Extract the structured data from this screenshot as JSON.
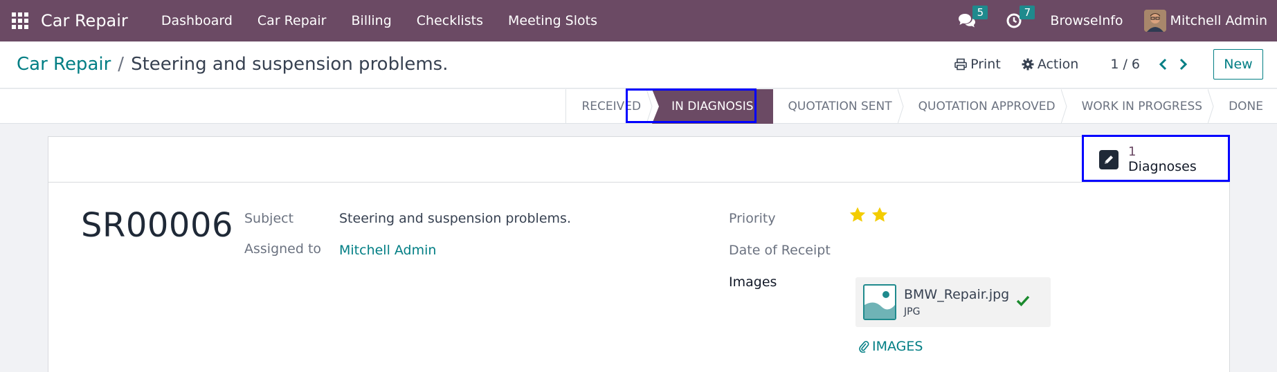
{
  "navbar": {
    "app_title": "Car Repair",
    "menu": [
      "Dashboard",
      "Car Repair",
      "Billing",
      "Checklists",
      "Meeting Slots"
    ],
    "messages_count": "5",
    "activities_count": "7",
    "company": "BrowseInfo",
    "user_name": "Mitchell Admin"
  },
  "breadcrumb": {
    "parent": "Car Repair",
    "separator": "/",
    "current": "Steering and suspension problems."
  },
  "control": {
    "print_label": "Print",
    "action_label": "Action",
    "pager": "1 / 6",
    "new_label": "New"
  },
  "statusbar": {
    "stages": [
      "RECEIVED",
      "IN DIAGNOSIS",
      "QUOTATION SENT",
      "QUOTATION APPROVED",
      "WORK IN PROGRESS",
      "DONE"
    ],
    "active": "IN DIAGNOSIS"
  },
  "smart_button": {
    "value": "1",
    "label": "Diagnoses"
  },
  "form": {
    "reference": "SR00006",
    "subject_label": "Subject",
    "subject_value": "Steering and suspension problems.",
    "assigned_label": "Assigned to",
    "assigned_value": "Mitchell Admin",
    "priority_label": "Priority",
    "priority_stars": 2,
    "receipt_label": "Date of Receipt",
    "receipt_value": "",
    "images_label": "Images",
    "attachment_name": "BMW_Repair.jpg",
    "attachment_type": "JPG",
    "images_button": "IMAGES"
  },
  "colors": {
    "brand": "#6b4a64",
    "link": "#017e84",
    "badge": "#1f8a8d",
    "star": "#f3cc00",
    "highlight": "#0000ff"
  }
}
